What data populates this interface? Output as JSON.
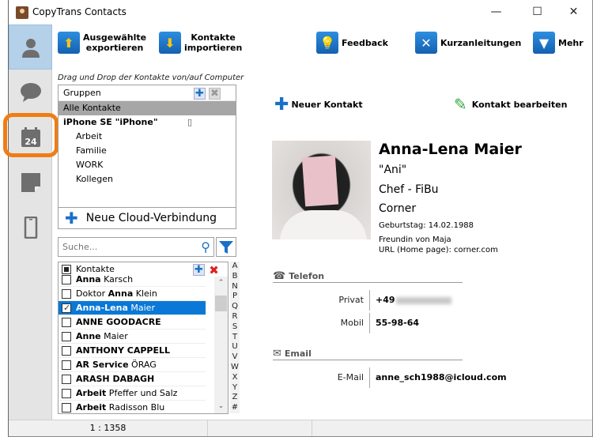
{
  "window": {
    "title": "CopyTrans Contacts",
    "controls": {
      "minimize": "—",
      "maximize": "☐",
      "close": "✕"
    }
  },
  "sidebar": {
    "items": [
      {
        "name": "contacts",
        "icon": "person-icon",
        "active": true
      },
      {
        "name": "messages",
        "icon": "speech-bubble-icon",
        "active": false
      },
      {
        "name": "calendar",
        "icon": "calendar-icon",
        "label": "24",
        "active": false,
        "highlighted": true
      },
      {
        "name": "notes",
        "icon": "note-icon",
        "active": false
      },
      {
        "name": "device",
        "icon": "phone-icon",
        "active": false
      }
    ]
  },
  "toolbar": {
    "export_line1": "Ausgewählte",
    "export_line2": "exportieren",
    "import_line1": "Kontakte",
    "import_line2": "importieren",
    "feedback": "Feedback",
    "guides": "Kurzanleitungen",
    "more": "Mehr"
  },
  "groups_panel": {
    "hint": "Drag und Drop der Kontakte von/auf Computer",
    "header": "Gruppen",
    "all_contacts": "Alle Kontakte",
    "device_name": "iPhone SE \"iPhone\"",
    "groups": [
      "Arbeit",
      "Familie",
      "WORK",
      "Kollegen"
    ],
    "new_cloud": "Neue Cloud-Verbindung"
  },
  "search": {
    "placeholder": "Suche..."
  },
  "contacts_list": {
    "header": "Kontakte",
    "rows": [
      {
        "bold": "Anna",
        "rest": " Karsch",
        "checked": false,
        "selected": false
      },
      {
        "pre": "Doktor ",
        "bold": "Anna",
        "rest": " Klein",
        "checked": false,
        "selected": false
      },
      {
        "bold": "Anna-Lena",
        "rest": " Maier",
        "checked": true,
        "selected": true
      },
      {
        "bold": "ANNE GOODACRE",
        "rest": "",
        "checked": false,
        "selected": false
      },
      {
        "bold": "Anne",
        "rest": " Maier",
        "checked": false,
        "selected": false
      },
      {
        "bold": "ANTHONY CAPPELL",
        "rest": "",
        "checked": false,
        "selected": false
      },
      {
        "bold": "AR Service",
        "rest": " ÖRAG",
        "checked": false,
        "selected": false
      },
      {
        "bold": "ARASH DABAGH",
        "rest": "",
        "checked": false,
        "selected": false
      },
      {
        "bold": "Arbeit",
        "rest": " Pfeffer und Salz",
        "checked": false,
        "selected": false
      },
      {
        "bold": "Arbeit",
        "rest": " Radisson Blu",
        "checked": false,
        "selected": false
      }
    ],
    "alphabet": [
      "A",
      "B",
      "N",
      "P",
      "Q",
      "R",
      "S",
      "T",
      "U",
      "V",
      "W",
      "X",
      "Y",
      "Z",
      "#"
    ]
  },
  "status": {
    "count": "1 : 1358"
  },
  "actions": {
    "new_contact": "Neuer Kontakt",
    "edit_contact": "Kontakt bearbeiten"
  },
  "contact": {
    "name": "Anna-Lena Maier",
    "nickname": "\"Ani\"",
    "title": "Chef - FiBu",
    "company": "Corner",
    "birthday": "Geburtstag: 14.02.1988",
    "note": "Freundin von Maja",
    "url": "URL (Home page): corner.com",
    "phone_section": "Telefon",
    "phones": [
      {
        "label": "Privat",
        "value": "+49",
        "blurred": true
      },
      {
        "label": "Mobil",
        "value": "55-98-64",
        "blurred": false
      }
    ],
    "email_section": "Email",
    "emails": [
      {
        "label": "E-Mail",
        "value": "anne_sch1988@icloud.com"
      }
    ]
  },
  "colors": {
    "accent": "#0a78d7",
    "highlight": "#f07d14",
    "sidebar_active": "#b5d1ea",
    "group_selected": "#a6a6a6"
  }
}
